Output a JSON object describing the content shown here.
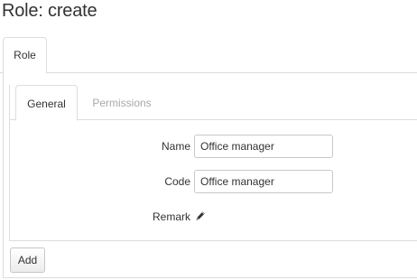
{
  "page": {
    "title": "Role: create"
  },
  "outer_tabs": [
    {
      "label": "Role",
      "active": true
    }
  ],
  "inner_tabs": [
    {
      "label": "General",
      "active": true
    },
    {
      "label": "Permissions",
      "active": false
    }
  ],
  "form": {
    "name": {
      "label": "Name",
      "value": "Office manager"
    },
    "code": {
      "label": "Code",
      "value": "Office manager"
    },
    "remark": {
      "label": "Remark",
      "icon": "pencil-icon"
    }
  },
  "actions": {
    "add_label": "Add"
  },
  "colors": {
    "border": "#dddddd",
    "inactive_tab_text": "#a8a8a8",
    "text": "#333333"
  }
}
